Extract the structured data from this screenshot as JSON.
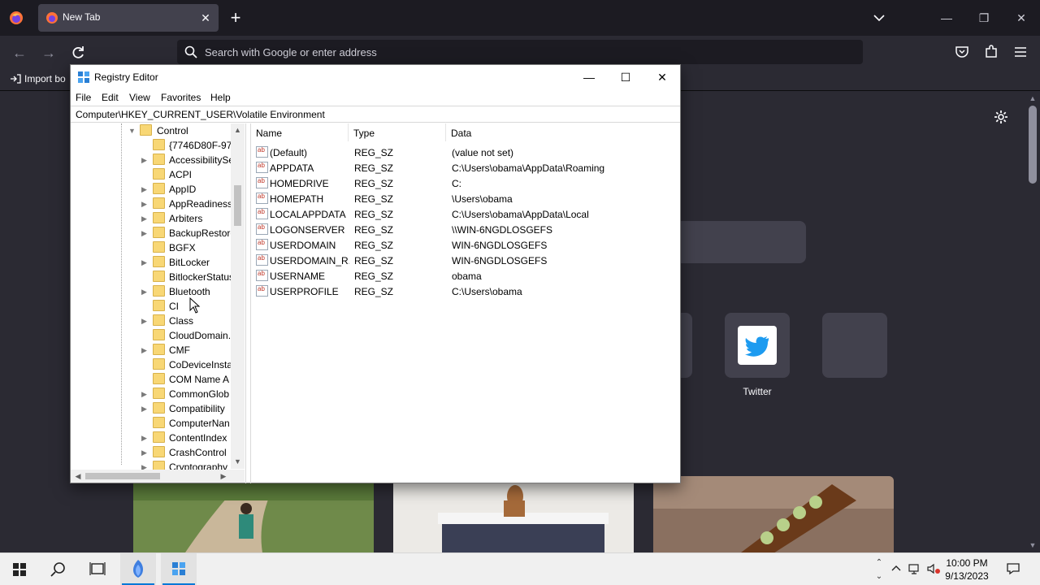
{
  "browser": {
    "tab_title": "New Tab",
    "url_placeholder": "Search with Google or enter address",
    "bookmarks_import": "Import bo",
    "shortcuts": [
      {
        "label": "Twitter"
      }
    ]
  },
  "regedit": {
    "title": "Registry Editor",
    "menu": [
      "File",
      "Edit",
      "View",
      "Favorites",
      "Help"
    ],
    "address": "Computer\\HKEY_CURRENT_USER\\Volatile Environment",
    "tree_root": "Control",
    "tree_items": [
      "{7746D80F-97E",
      "AccessibilitySe",
      "ACPI",
      "AppID",
      "AppReadiness",
      "Arbiters",
      "BackupRestore",
      "BGFX",
      "BitLocker",
      "BitlockerStatus",
      "Bluetooth",
      "CI",
      "Class",
      "CloudDomain.",
      "CMF",
      "CoDeviceInsta",
      "COM Name A",
      "CommonGlob",
      "Compatibility",
      "ComputerNan",
      "ContentIndex",
      "CrashControl",
      "Cryptography"
    ],
    "columns": {
      "name": "Name",
      "type": "Type",
      "data": "Data"
    },
    "values": [
      {
        "name": "(Default)",
        "type": "REG_SZ",
        "data": "(value not set)"
      },
      {
        "name": "APPDATA",
        "type": "REG_SZ",
        "data": "C:\\Users\\obama\\AppData\\Roaming"
      },
      {
        "name": "HOMEDRIVE",
        "type": "REG_SZ",
        "data": "C:"
      },
      {
        "name": "HOMEPATH",
        "type": "REG_SZ",
        "data": "\\Users\\obama"
      },
      {
        "name": "LOCALAPPDATA",
        "type": "REG_SZ",
        "data": "C:\\Users\\obama\\AppData\\Local"
      },
      {
        "name": "LOGONSERVER",
        "type": "REG_SZ",
        "data": "\\\\WIN-6NGDLOSGEFS"
      },
      {
        "name": "USERDOMAIN",
        "type": "REG_SZ",
        "data": "WIN-6NGDLOSGEFS"
      },
      {
        "name": "USERDOMAIN_R...",
        "type": "REG_SZ",
        "data": "WIN-6NGDLOSGEFS"
      },
      {
        "name": "USERNAME",
        "type": "REG_SZ",
        "data": "obama"
      },
      {
        "name": "USERPROFILE",
        "type": "REG_SZ",
        "data": "C:\\Users\\obama"
      }
    ]
  },
  "taskbar": {
    "time": "10:00 PM",
    "date": "9/13/2023"
  },
  "colors": {
    "accent": "#0078d7",
    "ff_dark": "#1c1b22",
    "ff_toolbar": "#2b2a33",
    "folder": "#f8d775"
  }
}
